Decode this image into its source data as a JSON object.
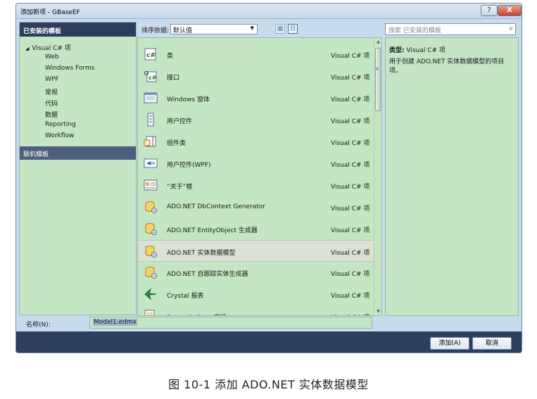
{
  "window": {
    "title": "添加新项 - GBaseEF",
    "help_label": "?",
    "close_label": "X"
  },
  "left_panel": {
    "header": "已安装的模板",
    "tree_root": "Visual C# 项",
    "tree_items": [
      "Web",
      "Windows Forms",
      "WPF",
      "常规",
      "代码",
      "数据",
      "Reporting",
      "Workflow"
    ],
    "online": "联机模板"
  },
  "sort": {
    "label": "排序依据:",
    "value": "默认值"
  },
  "search": {
    "placeholder": "搜索 已安装的模板"
  },
  "items": [
    {
      "name": "类",
      "type": "Visual C# 项",
      "icon": "class-icon"
    },
    {
      "name": "接口",
      "type": "Visual C# 项",
      "icon": "interface-icon"
    },
    {
      "name": "Windows 窗体",
      "type": "Visual C# 项",
      "icon": "form-icon"
    },
    {
      "name": "用户控件",
      "type": "Visual C# 项",
      "icon": "user-control-icon"
    },
    {
      "name": "组件类",
      "type": "Visual C# 项",
      "icon": "component-icon"
    },
    {
      "name": "用户控件(WPF)",
      "type": "Visual C# 项",
      "icon": "wpf-control-icon"
    },
    {
      "name": "“关于”框",
      "type": "Visual C# 项",
      "icon": "about-box-icon"
    },
    {
      "name": "ADO.NET DbContext Generator",
      "type": "Visual C# 项",
      "icon": "database-icon"
    },
    {
      "name": "ADO.NET EntityObject 生成器",
      "type": "Visual C# 项",
      "icon": "database-icon"
    },
    {
      "name": "ADO.NET 实体数据模型",
      "type": "Visual C# 项",
      "icon": "database-icon",
      "selected": true
    },
    {
      "name": "ADO.NET 自跟踪实体生成器",
      "type": "Visual C# 项",
      "icon": "database-icon"
    },
    {
      "name": "Crystal 报表",
      "type": "Visual C# 项",
      "icon": "crystal-report-icon"
    },
    {
      "name": "Dynamic Data 字段",
      "type": "Visual C# 项",
      "icon": "dynamic-data-icon"
    }
  ],
  "details": {
    "type_label": "类型:",
    "type_value": "Visual C# 项",
    "description": "用于创建 ADO.NET 实体数据模型的项目项。"
  },
  "name_field": {
    "label": "名称(N):",
    "value": "Model1.edmx"
  },
  "buttons": {
    "add": "添加(A)",
    "cancel": "取消"
  },
  "caption": "图 10-1 添加 ADO.NET 实体数据模型"
}
